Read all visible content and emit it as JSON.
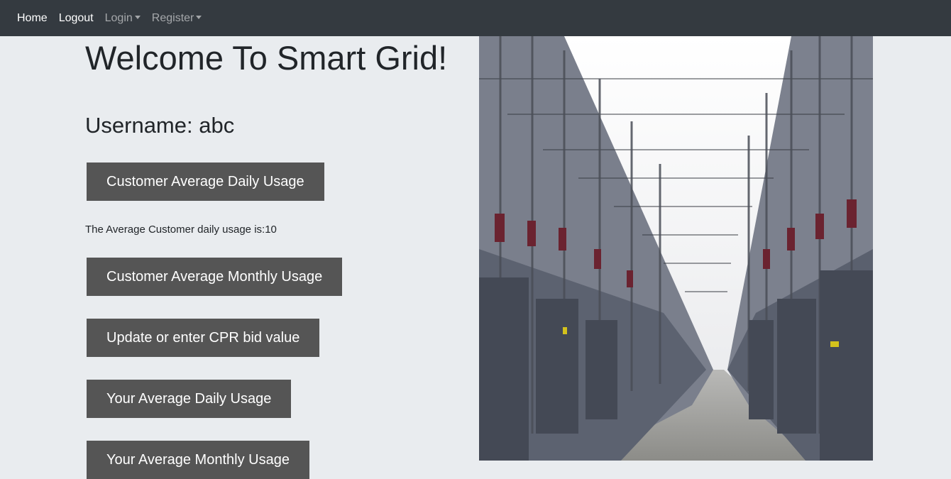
{
  "nav": {
    "home": "Home",
    "logout": "Logout",
    "login": "Login",
    "register": "Register"
  },
  "main": {
    "title": "Welcome To Smart Grid!",
    "username": "Username: abc",
    "buttons": {
      "customer_daily": "Customer Average Daily Usage",
      "customer_monthly": "Customer Average Monthly Usage",
      "cpr_bid": "Update or enter CPR bid value",
      "your_daily": "Your Average Daily Usage",
      "your_monthly": "Your Average Monthly Usage"
    },
    "daily_result": "The Average Customer daily usage is:10"
  },
  "colors": {
    "navbar_bg": "#343a40",
    "page_bg": "#e9ecef",
    "button_bg": "#555555",
    "button_text": "#ffffff"
  },
  "icons": [
    "login-dropdown-caret-icon",
    "register-dropdown-caret-icon"
  ]
}
